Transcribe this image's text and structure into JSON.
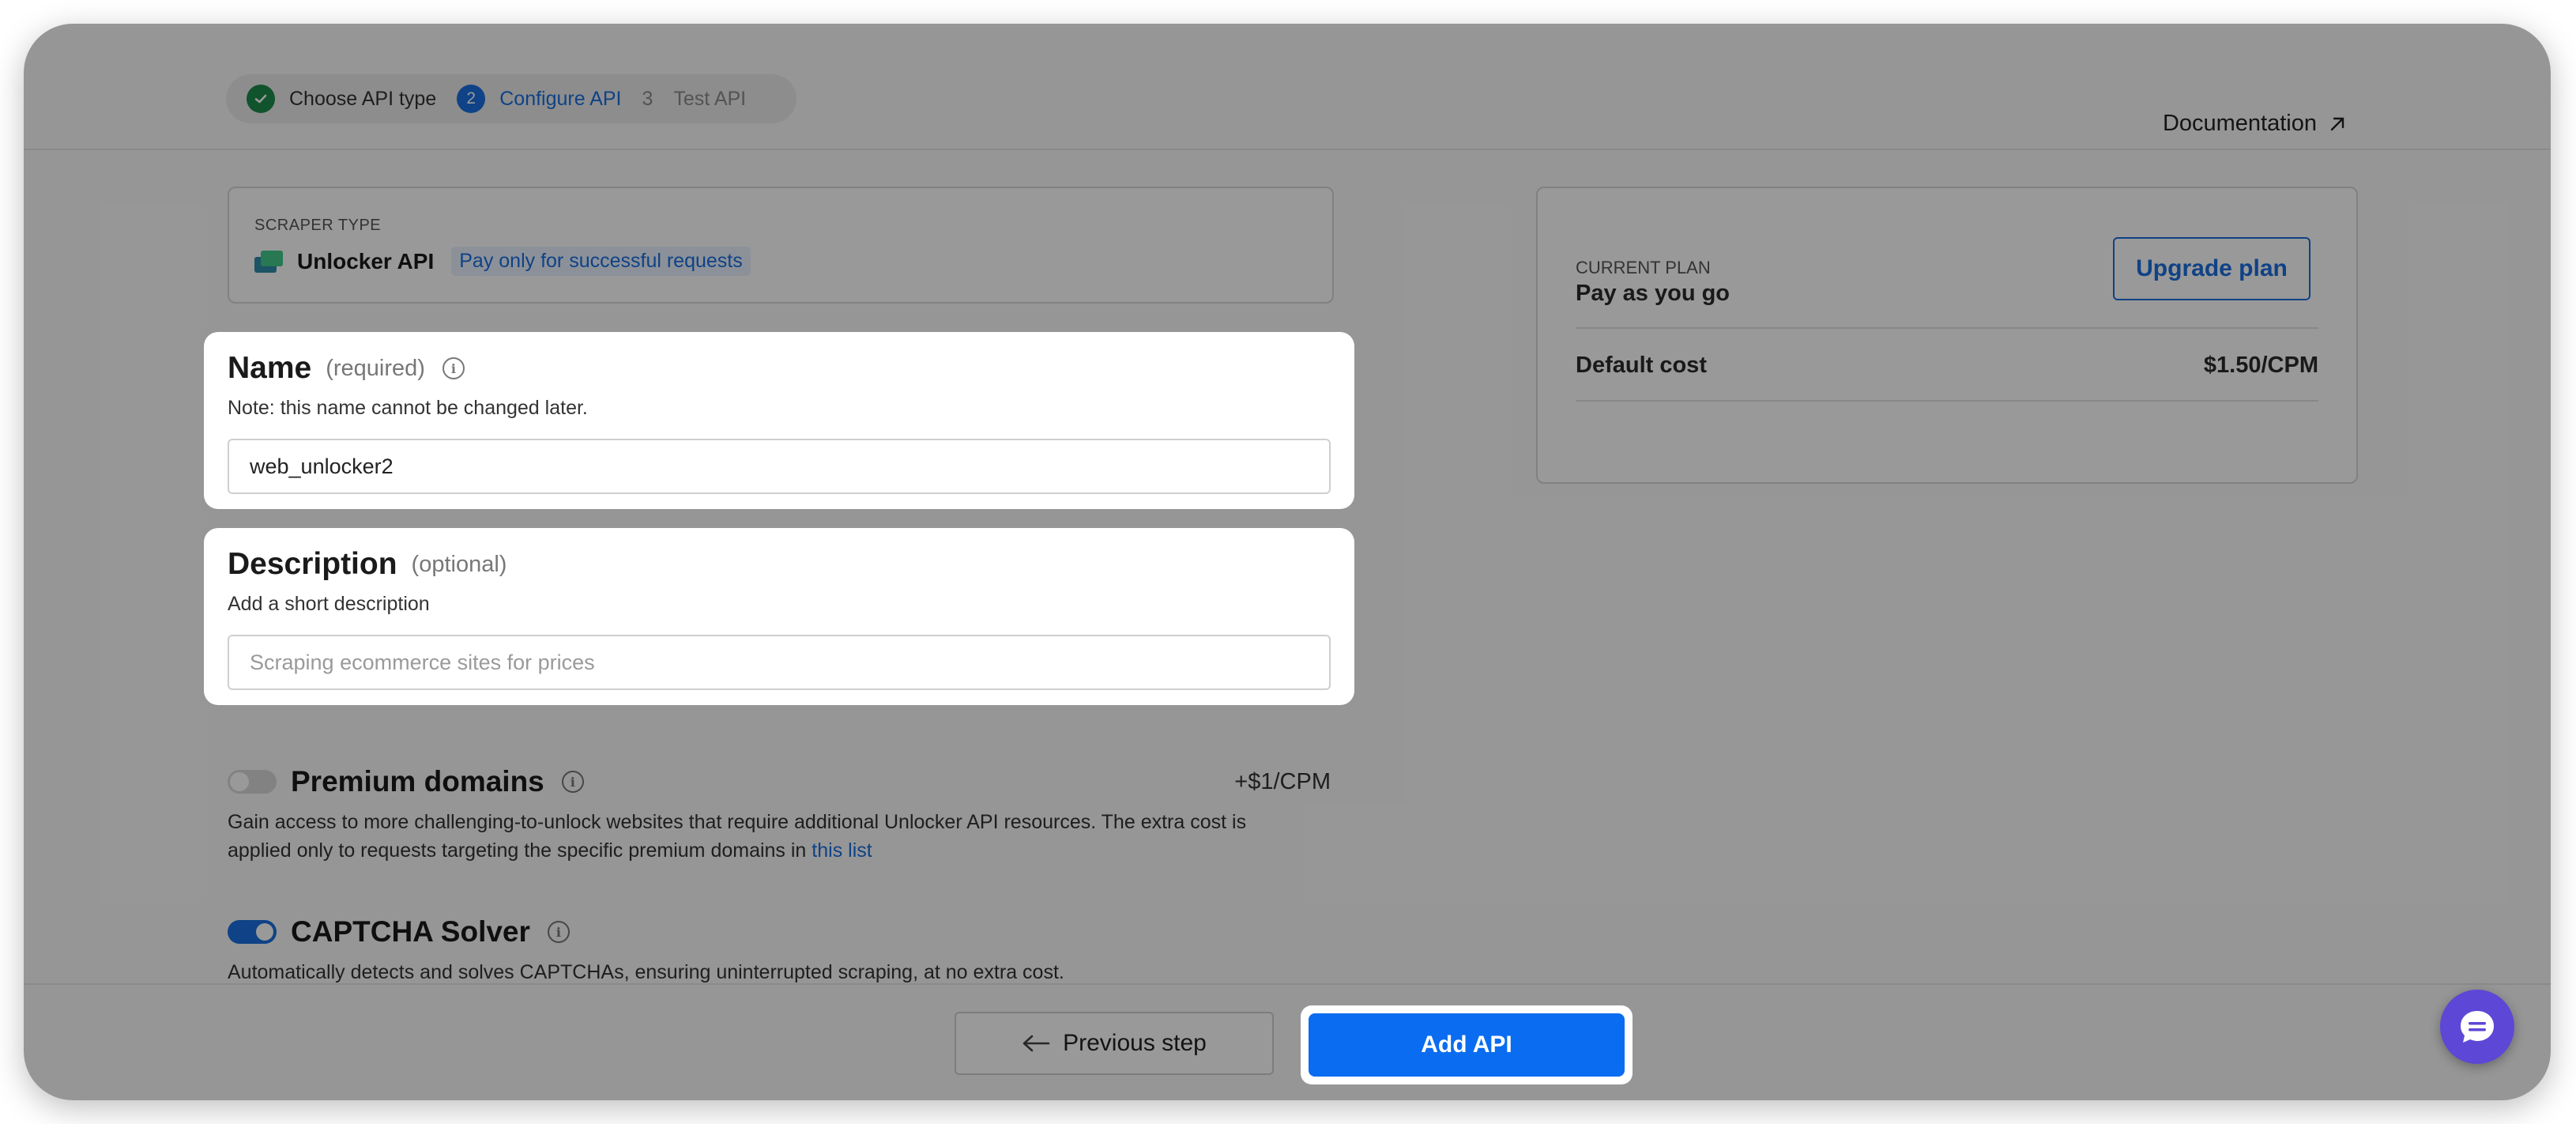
{
  "stepper": {
    "steps": [
      {
        "number": "1",
        "label": "Choose API type",
        "state": "done"
      },
      {
        "number": "2",
        "label": "Configure API",
        "state": "active"
      },
      {
        "number": "3",
        "label": "Test API",
        "state": "inactive"
      }
    ]
  },
  "header": {
    "documentation_label": "Documentation"
  },
  "scraper": {
    "label": "SCRAPER TYPE",
    "name": "Unlocker API",
    "badge": "Pay only for successful requests"
  },
  "name_field": {
    "title": "Name",
    "hint": "(required)",
    "note": "Note: this name cannot be changed later.",
    "value": "web_unlocker2"
  },
  "description_field": {
    "title": "Description",
    "hint": "(optional)",
    "note": "Add a short description",
    "placeholder": "Scraping ecommerce sites for prices"
  },
  "premium": {
    "title": "Premium domains",
    "price": "+$1/CPM",
    "enabled": false,
    "desc_line1": "Gain access to more challenging-to-unlock websites that require additional Unlocker API resources. The extra cost is",
    "desc_line2": "applied only to requests targeting the specific premium domains in",
    "link": "this list"
  },
  "captcha": {
    "title": "CAPTCHA Solver",
    "enabled": true,
    "desc": "Automatically detects and solves CAPTCHAs, ensuring uninterrupted scraping, at no extra cost."
  },
  "plan": {
    "label": "CURRENT PLAN",
    "value": "Pay as you go",
    "upgrade_label": "Upgrade plan",
    "cost_label": "Default cost",
    "cost_value": "$1.50/CPM"
  },
  "footer": {
    "prev_label": "Previous step",
    "add_label": "Add API"
  },
  "colors": {
    "accent": "#1a6fe0",
    "success": "#1b8a4a",
    "chat": "#5d47d6"
  }
}
